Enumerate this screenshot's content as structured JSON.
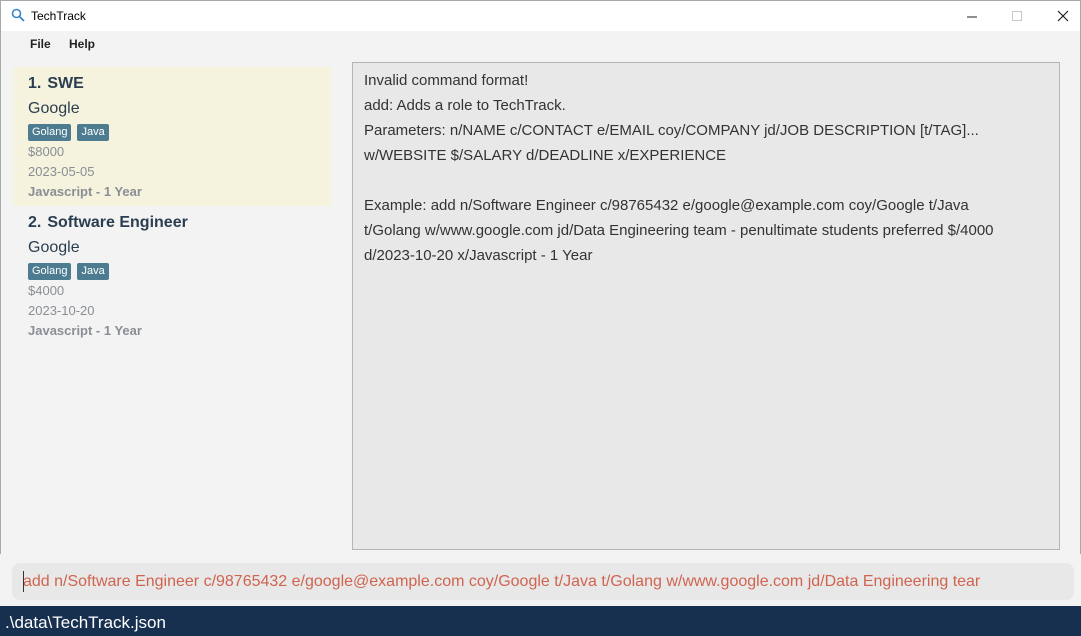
{
  "window": {
    "title": "TechTrack"
  },
  "menu": {
    "file": "File",
    "help": "Help"
  },
  "roles": [
    {
      "index": "1.",
      "title": "SWE",
      "company": "Google",
      "tags": [
        "Golang",
        "Java"
      ],
      "salary": "$8000",
      "deadline": "2023-05-05",
      "experience": "Javascript - 1 Year"
    },
    {
      "index": "2.",
      "title": "Software Engineer",
      "company": "Google",
      "tags": [
        "Golang",
        "Java"
      ],
      "salary": "$4000",
      "deadline": "2023-10-20",
      "experience": "Javascript - 1 Year"
    }
  ],
  "result": {
    "lines": [
      "Invalid command format!",
      "add: Adds a role to TechTrack.",
      "Parameters: n/NAME c/CONTACT e/EMAIL coy/COMPANY jd/JOB DESCRIPTION [t/TAG]...",
      "w/WEBSITE $/SALARY d/DEADLINE x/EXPERIENCE",
      "",
      "Example: add n/Software Engineer c/98765432 e/google@example.com coy/Google t/Java",
      "t/Golang w/www.google.com jd/Data Engineering team - penultimate students preferred $/4000",
      "d/2023-10-20 x/Javascript - 1 Year"
    ]
  },
  "command": {
    "value": "add n/Software Engineer c/98765432 e/google@example.com coy/Google t/Java t/Golang w/www.google.com jd/Data Engineering tear"
  },
  "status": {
    "path": ".\\data\\TechTrack.json"
  },
  "colors": {
    "selected_card": "#f5f2de",
    "tag": "#4d7c91",
    "status_bar": "#17304f",
    "command_text": "#d0644f"
  }
}
